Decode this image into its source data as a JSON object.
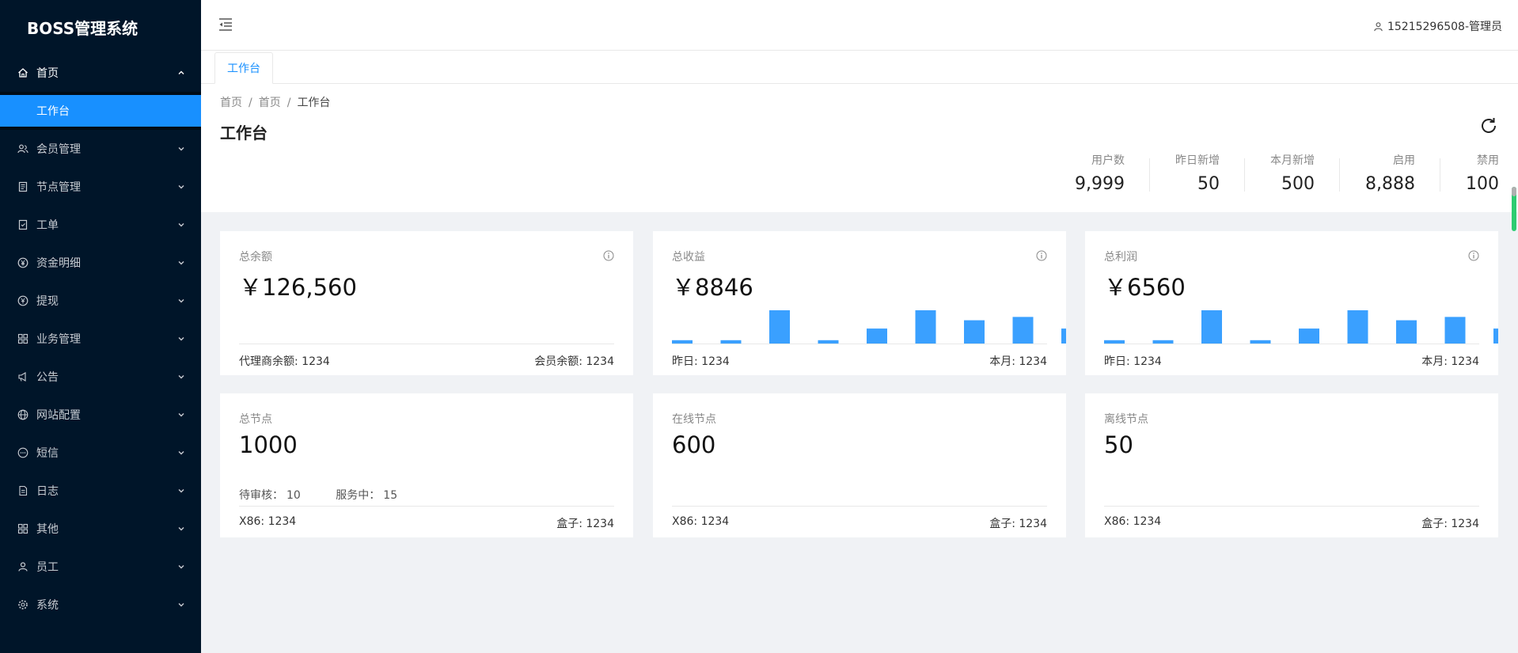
{
  "app": {
    "title": "BOSS管理系统"
  },
  "sidebar": {
    "items": [
      {
        "label": "首页",
        "icon": "home-icon",
        "open": true,
        "children": [
          {
            "label": "工作台",
            "active": true
          }
        ]
      },
      {
        "label": "会员管理",
        "icon": "users-icon"
      },
      {
        "label": "节点管理",
        "icon": "book-icon"
      },
      {
        "label": "工单",
        "icon": "ticket-icon"
      },
      {
        "label": "资金明细",
        "icon": "yen-icon"
      },
      {
        "label": "提现",
        "icon": "withdraw-icon"
      },
      {
        "label": "业务管理",
        "icon": "grid-icon"
      },
      {
        "label": "公告",
        "icon": "megaphone-icon"
      },
      {
        "label": "网站配置",
        "icon": "globe-icon"
      },
      {
        "label": "短信",
        "icon": "message-icon"
      },
      {
        "label": "日志",
        "icon": "log-icon"
      },
      {
        "label": "其他",
        "icon": "apps-icon"
      },
      {
        "label": "员工",
        "icon": "user-icon"
      },
      {
        "label": "系统",
        "icon": "gear-icon"
      }
    ]
  },
  "header": {
    "user": "15215296508-管理员"
  },
  "tabs": [
    {
      "label": "工作台",
      "active": true
    }
  ],
  "breadcrumb": [
    "首页",
    "首页",
    "工作台"
  ],
  "page": {
    "title": "工作台"
  },
  "stats": [
    {
      "label": "用户数",
      "value": "9,999"
    },
    {
      "label": "昨日新增",
      "value": "50"
    },
    {
      "label": "本月新增",
      "value": "500"
    },
    {
      "label": "启用",
      "value": "8,888"
    },
    {
      "label": "禁用",
      "value": "100"
    }
  ],
  "cards": {
    "balance": {
      "title": "总余额",
      "value": "￥126,560",
      "foot_left": "代理商余额: 1234",
      "foot_right": "会员余额: 1234"
    },
    "income": {
      "title": "总收益",
      "value": "￥8846",
      "foot_left": "昨日: 1234",
      "foot_right": "本月: 1234"
    },
    "profit": {
      "title": "总利润",
      "value": "￥6560",
      "foot_left": "昨日: 1234",
      "foot_right": "本月: 1234"
    },
    "nodes": {
      "title": "总节点",
      "value": "1000",
      "pending_label": "待审核：",
      "pending_value": "10",
      "serving_label": "服务中：",
      "serving_value": "15",
      "foot_left": "X86: 1234",
      "foot_right": "盒子: 1234"
    },
    "online": {
      "title": "在线节点",
      "value": "600",
      "foot_left": "X86: 1234",
      "foot_right": "盒子: 1234"
    },
    "offline": {
      "title": "离线节点",
      "value": "50",
      "foot_left": "X86: 1234",
      "foot_right": "盒子: 1234"
    }
  },
  "chart_data": [
    {
      "type": "bar",
      "series": [
        {
          "values": [
            1,
            1,
            10,
            1,
            4.5,
            10,
            7,
            8,
            4.5
          ]
        }
      ],
      "ylim": [
        0,
        10
      ],
      "color": "#3aa0ff"
    },
    {
      "type": "bar",
      "series": [
        {
          "values": [
            1,
            1,
            10,
            1,
            4.5,
            10,
            7,
            8,
            4.5
          ]
        }
      ],
      "ylim": [
        0,
        10
      ],
      "color": "#3aa0ff"
    }
  ],
  "colors": {
    "sidebar_bg": "#001529",
    "accent": "#1890ff",
    "bar": "#3aa0ff"
  }
}
